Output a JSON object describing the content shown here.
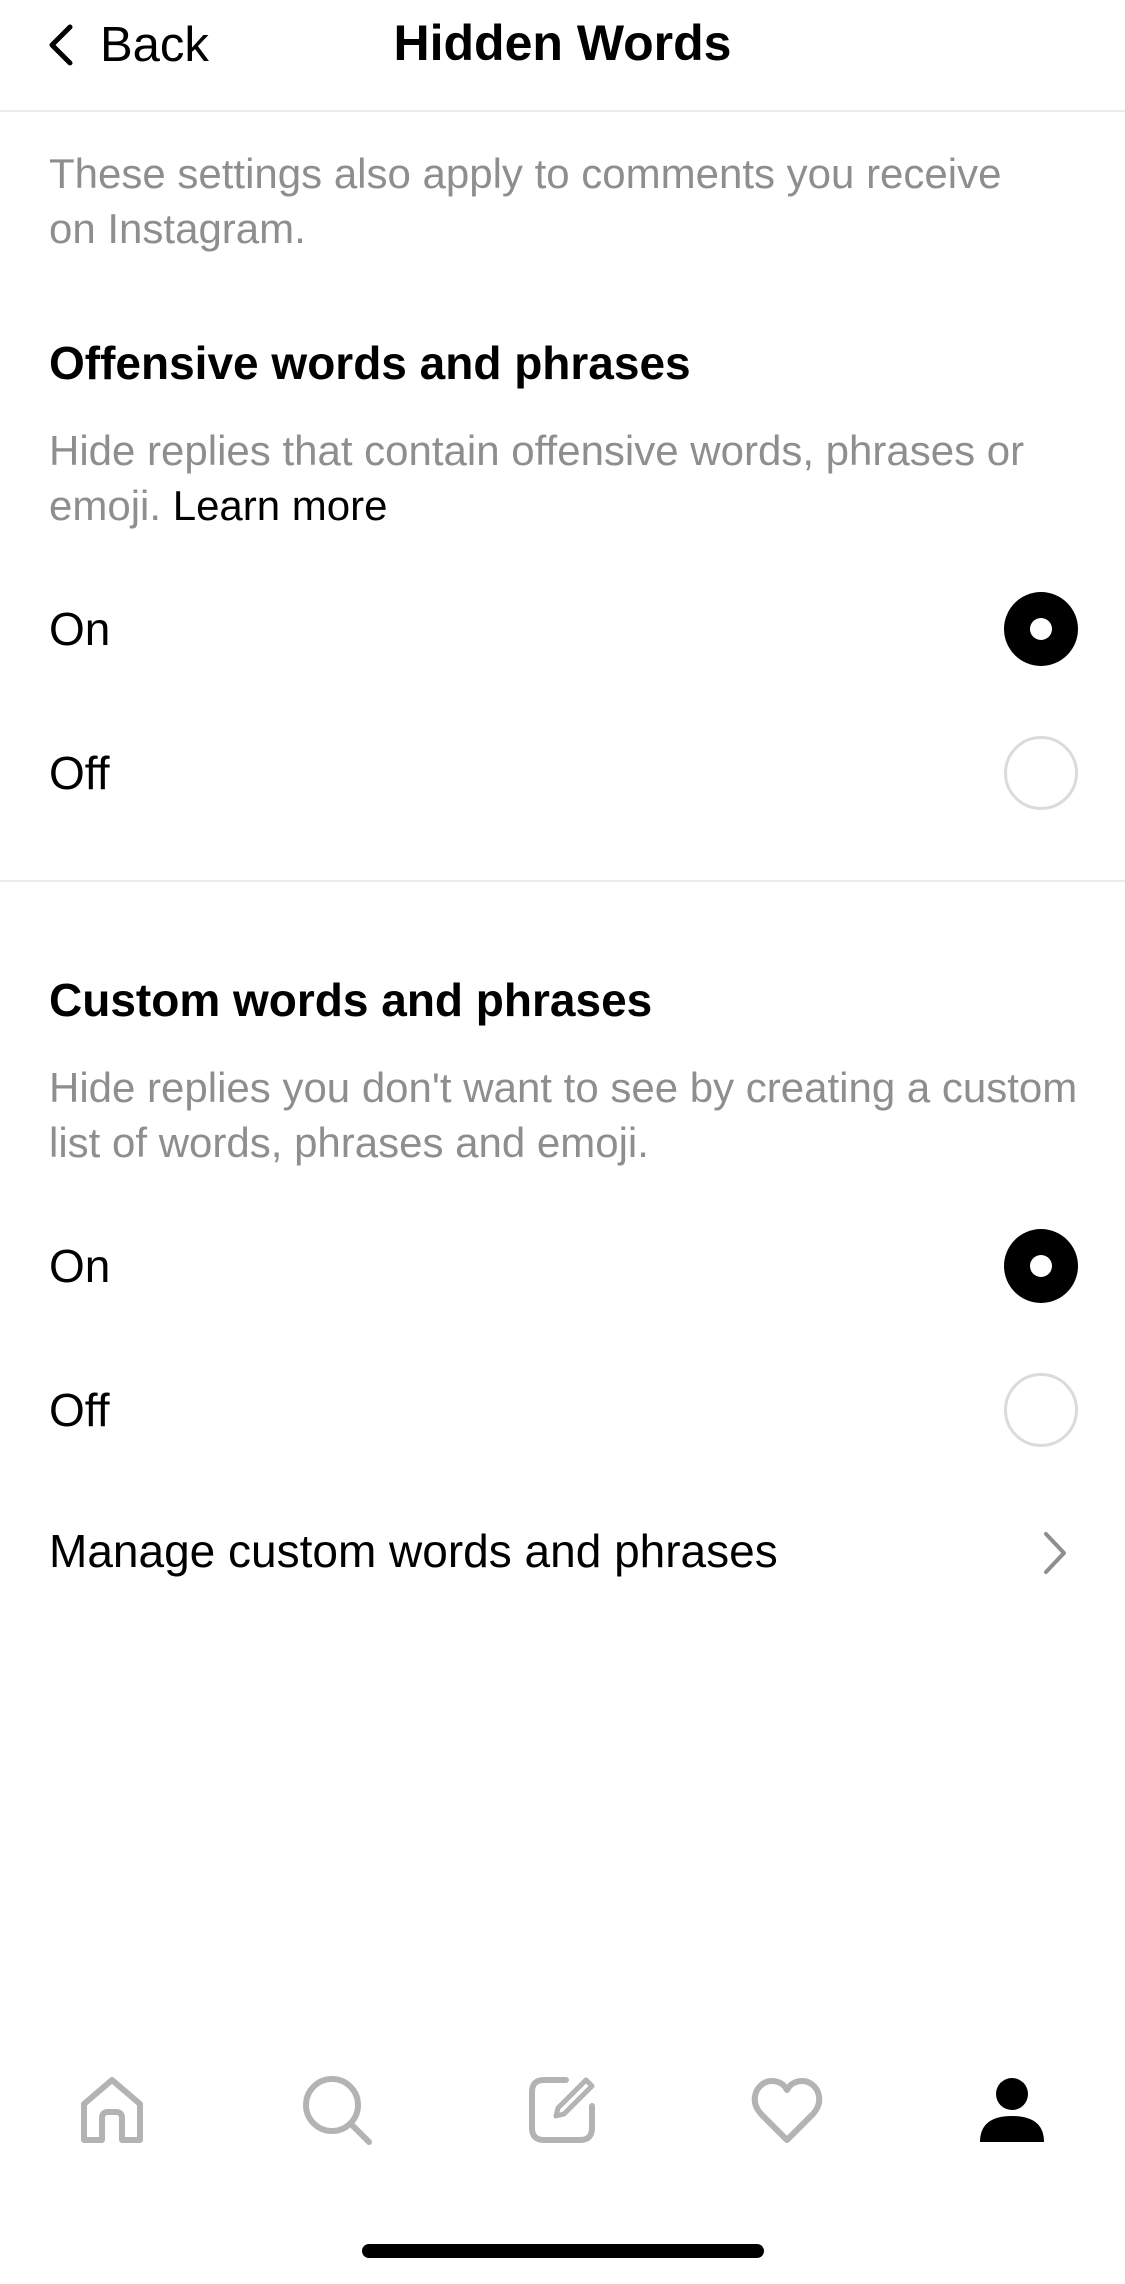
{
  "header": {
    "back_label": "Back",
    "title": "Hidden Words"
  },
  "intro": "These settings also apply to comments you receive on Instagram.",
  "offensive": {
    "title": "Offensive words and phrases",
    "description": "Hide replies that contain offensive words, phrases or emoji.",
    "learn_more": "Learn more",
    "options": [
      {
        "label": "On",
        "selected": true
      },
      {
        "label": "Off",
        "selected": false
      }
    ]
  },
  "custom": {
    "title": "Custom words and phrases",
    "description": "Hide replies you don't want to see by creating a custom list of words, phrases and emoji.",
    "options": [
      {
        "label": "On",
        "selected": true
      },
      {
        "label": "Off",
        "selected": false
      }
    ],
    "manage_label": "Manage custom words and phrases"
  },
  "tabbar": {
    "tabs": [
      {
        "icon": "home-icon",
        "active": false
      },
      {
        "icon": "search-icon",
        "active": false
      },
      {
        "icon": "compose-icon",
        "active": false
      },
      {
        "icon": "heart-icon",
        "active": false
      },
      {
        "icon": "profile-icon",
        "active": true
      }
    ],
    "inactive_color": "#b3b3b3",
    "active_color": "#000000"
  }
}
